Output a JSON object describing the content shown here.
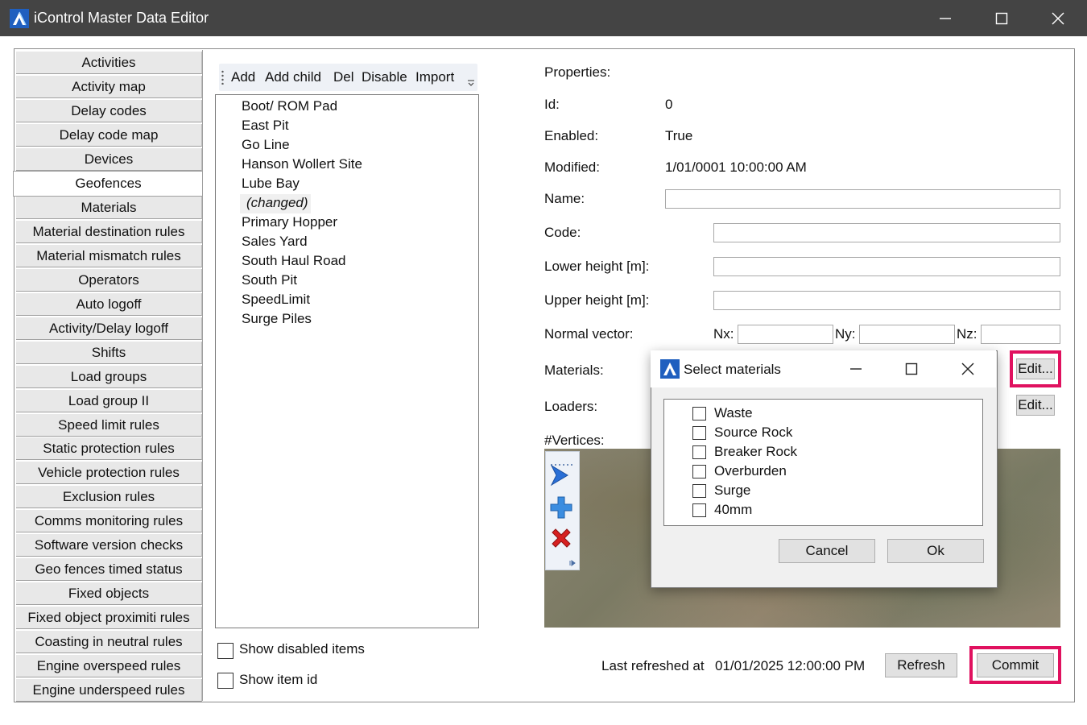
{
  "window": {
    "title": "iControl Master Data Editor"
  },
  "nav": {
    "items": [
      "Activities",
      "Activity map",
      "Delay codes",
      "Delay code map",
      "Devices",
      "Geofences",
      "Materials",
      "Material destination rules",
      "Material mismatch rules",
      "Operators",
      "Auto logoff",
      "Activity/Delay logoff",
      "Shifts",
      "Load groups",
      "Load group II",
      "Speed limit rules",
      "Static protection rules",
      "Vehicle protection rules",
      "Exclusion rules",
      "Comms monitoring rules",
      "Software version checks",
      "Geo fences timed status",
      "Fixed objects",
      "Fixed object proximiti rules",
      "Coasting in neutral rules",
      "Engine overspeed rules",
      "Engine underspeed rules"
    ],
    "active": "Geofences"
  },
  "toolbar": {
    "add": "Add",
    "add_child": "Add child",
    "del": "Del",
    "disable": "Disable",
    "import": "Import"
  },
  "list": {
    "items": [
      "Boot/ ROM Pad",
      "East Pit",
      "Go Line",
      "Hanson Wollert Site",
      "Lube Bay",
      "(changed)",
      "Primary Hopper",
      "Sales Yard",
      "South Haul Road",
      "South Pit",
      "SpeedLimit",
      "Surge Piles"
    ],
    "show_disabled_label": "Show disabled items",
    "show_id_label": "Show item id"
  },
  "properties": {
    "header": "Properties:",
    "id_label": "Id:",
    "id_value": "0",
    "enabled_label": "Enabled:",
    "enabled_value": "True",
    "modified_label": "Modified:",
    "modified_value": "1/01/0001 10:00:00 AM",
    "name_label": "Name:",
    "name_value": "",
    "code_label": "Code:",
    "code_value": "",
    "lower_label": "Lower height [m]:",
    "lower_value": "",
    "upper_label": "Upper height [m]:",
    "upper_value": "",
    "normal_label": "Normal vector:",
    "nx_label": "Nx:",
    "ny_label": "Ny:",
    "nz_label": "Nz:",
    "materials_label": "Materials:",
    "loaders_label": "Loaders:",
    "edit_label": "Edit...",
    "vertices_label": "#Vertices:"
  },
  "footer": {
    "last_refreshed_label": "Last refreshed at",
    "last_refreshed_value": "01/01/2025 12:00:00 PM",
    "refresh": "Refresh",
    "commit": "Commit"
  },
  "dialog": {
    "title": "Select materials",
    "items": [
      "Waste",
      "Source Rock",
      "Breaker Rock",
      "Overburden",
      "Surge",
      "40mm"
    ],
    "cancel": "Cancel",
    "ok": "Ok"
  },
  "colors": {
    "highlight": "#e0115f",
    "titlebar": "#444444"
  }
}
